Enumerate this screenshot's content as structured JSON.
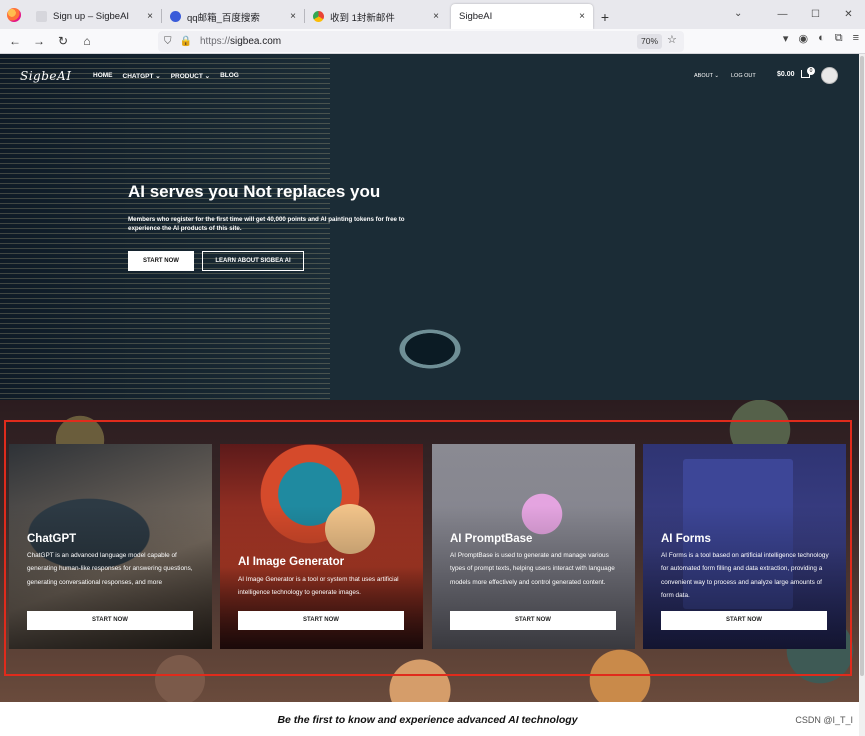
{
  "browser": {
    "tabs": [
      {
        "title": "Sign up – SigbeAI",
        "close": "×"
      },
      {
        "title": "qq邮箱_百度搜索",
        "close": "×"
      },
      {
        "title": "收到 1封新邮件",
        "close": "×"
      },
      {
        "title": "SigbeAI",
        "close": "×"
      }
    ],
    "new_tab": "+",
    "tab_list": "⌄",
    "window_controls": {
      "minimize": "—",
      "maximize": "☐",
      "close": "✕"
    },
    "nav": {
      "back": "←",
      "forward": "→",
      "reload": "↻",
      "home": "⌂"
    },
    "url_proto": "https://",
    "url_host": "sigbea.com",
    "zoom": "70%",
    "toolbar_icons": [
      "pocket-icon",
      "account-icon",
      "vpn-icon",
      "extensions-icon",
      "menu-icon"
    ],
    "toolbar_glyphs": [
      "▾",
      "◉",
      "◐",
      "⧉",
      "≡"
    ],
    "shield": "⛉",
    "lock": "🔒",
    "bookmark": "☆"
  },
  "header": {
    "logo": "SigbeAI",
    "menu": [
      "HOME",
      "CHATGPT ⌄",
      "PRODUCT ⌄",
      "BLOG"
    ],
    "menu_right": [
      "ABOUT ⌄",
      "LOG OUT"
    ],
    "cart_total": "$0.00",
    "cart_count": "0"
  },
  "hero": {
    "title": "AI serves you Not replaces you",
    "subtitle": "Members who register for the first time will get 40,000 points and AI painting tokens for free to experience the AI products of this site.",
    "start_button": "START NOW",
    "learn_button": "LEARN ABOUT SIGBEA AI"
  },
  "cards": [
    {
      "title": "ChatGPT",
      "desc": "ChatGPT is an advanced language model capable of generating human-like responses for answering questions, generating conversational responses, and more",
      "button": "START NOW"
    },
    {
      "title": "AI Image Generator",
      "desc": "AI Image Generator is a tool or system that uses artificial intelligence technology to generate images.",
      "button": "START NOW"
    },
    {
      "title": "AI PromptBase",
      "desc": "AI PromptBase is used to generate and manage various types of prompt texts, helping users interact with language models more effectively and control generated content.",
      "button": "START NOW"
    },
    {
      "title": "AI Forms",
      "desc": "AI Forms is a tool based on artificial intelligence technology for automated form filling and data extraction, providing a convenient way to process and analyze large amounts of form data.",
      "button": "START NOW"
    }
  ],
  "footer_band": {
    "tagline": "Be the first to know and experience advanced AI technology",
    "watermark": "CSDN @I_T_I"
  },
  "colors": {
    "highlight_frame": "#e02b1c",
    "tab_bar": "#e8e8ed"
  }
}
